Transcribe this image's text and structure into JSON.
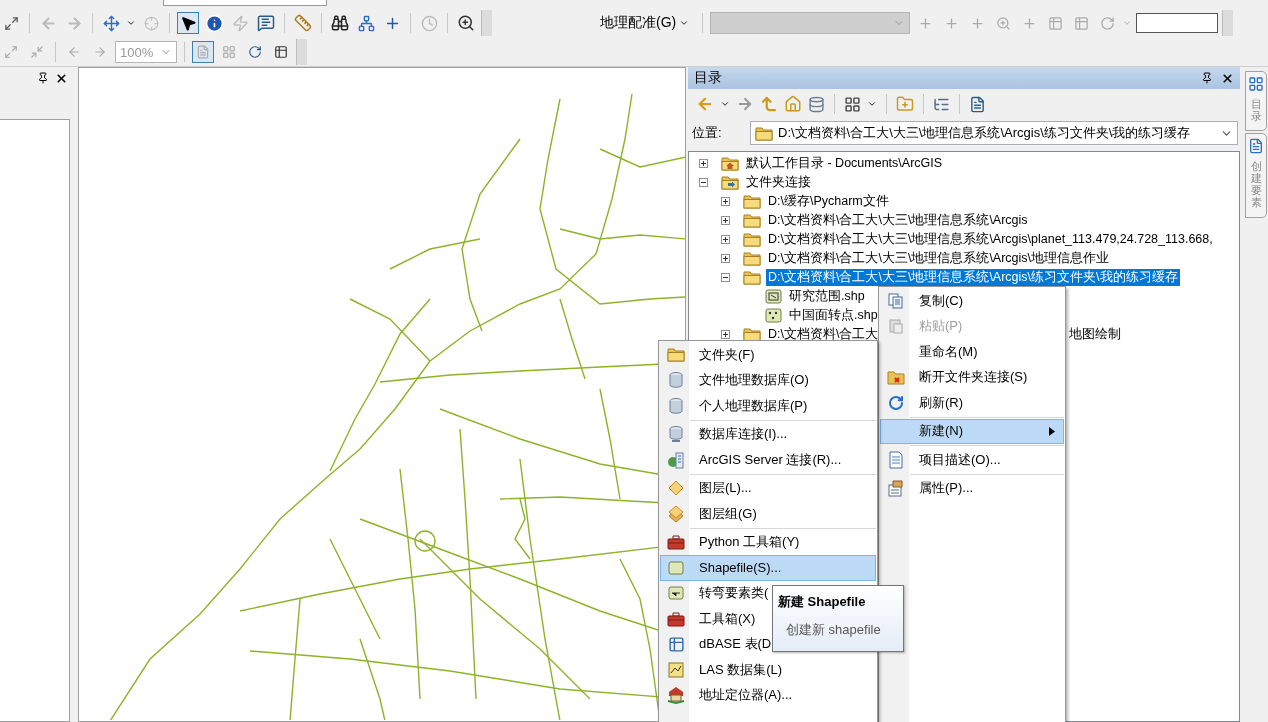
{
  "toolbar": {
    "pointer_tool": {
      "selected": true
    },
    "georeferencing_menu": "地理配准(G)",
    "page_zoom": "100%",
    "data_view_tool": {
      "selected": true
    }
  },
  "catalog": {
    "title": "目录",
    "location_label": "位置:",
    "location": "D:\\文档资料\\合工大\\大三\\地理信息系统\\Arcgis\\练习文件夹\\我的练习缓存",
    "tree": [
      {
        "kind": "home_folder",
        "label": "默认工作目录 - Documents\\ArcGIS",
        "expanded": false,
        "selected": false
      },
      {
        "kind": "connections",
        "label": "文件夹连接",
        "expanded": true,
        "selected": false,
        "children": [
          {
            "kind": "folder",
            "label": "D:\\缓存\\Pycharm文件",
            "expanded": false,
            "selected": false
          },
          {
            "kind": "folder",
            "label": "D:\\文档资料\\合工大\\大三\\地理信息系统\\Arcgis",
            "expanded": false,
            "selected": false
          },
          {
            "kind": "folder",
            "label": "D:\\文档资料\\合工大\\大三\\地理信息系统\\Arcgis\\planet_113.479,24.728_113.668,",
            "expanded": false,
            "selected": false
          },
          {
            "kind": "folder",
            "label": "D:\\文档资料\\合工大\\大三\\地理信息系统\\Arcgis\\地理信息作业",
            "expanded": false,
            "selected": false
          },
          {
            "kind": "folder",
            "label": "D:\\文档资料\\合工大\\大三\\地理信息系统\\Arcgis\\练习文件夹\\我的练习缓存",
            "expanded": true,
            "selected": true,
            "children": [
              {
                "kind": "polygon_shapefile",
                "label": "研究范围.shp",
                "selected": false
              },
              {
                "kind": "point_shapefile",
                "label": "中国面转点.shp",
                "selected": false
              }
            ]
          },
          {
            "kind": "folder",
            "label": "D:\\文档资料\\合工大",
            "label_tail": "地图绘制",
            "expanded": false,
            "selected": false
          }
        ]
      }
    ]
  },
  "context_menu": {
    "items": [
      {
        "kind": "item",
        "label": "复制(C)",
        "disabled": false,
        "selected": false,
        "submenu": false
      },
      {
        "kind": "item",
        "label": "粘贴(P)",
        "disabled": true,
        "selected": false,
        "submenu": false
      },
      {
        "kind": "item",
        "label": "重命名(M)",
        "disabled": false,
        "selected": false,
        "submenu": false
      },
      {
        "kind": "item",
        "label": "断开文件夹连接(S)",
        "disabled": false,
        "selected": false,
        "submenu": false
      },
      {
        "kind": "item",
        "label": "刷新(R)",
        "disabled": false,
        "selected": false,
        "submenu": false
      },
      {
        "kind": "separator"
      },
      {
        "kind": "item",
        "label": "新建(N)",
        "disabled": false,
        "selected": true,
        "submenu": true
      },
      {
        "kind": "separator"
      },
      {
        "kind": "item",
        "label": "项目描述(O)...",
        "disabled": false,
        "selected": false,
        "submenu": false
      },
      {
        "kind": "separator"
      },
      {
        "kind": "item",
        "label": "属性(P)...",
        "disabled": false,
        "selected": false,
        "submenu": false
      }
    ]
  },
  "new_submenu": {
    "items": [
      {
        "kind": "item",
        "label": "文件夹(F)",
        "disabled": false,
        "selected": false,
        "submenu": false
      },
      {
        "kind": "item",
        "label": "文件地理数据库(O)",
        "disabled": false,
        "selected": false,
        "submenu": false
      },
      {
        "kind": "item",
        "label": "个人地理数据库(P)",
        "disabled": false,
        "selected": false,
        "submenu": false
      },
      {
        "kind": "separator"
      },
      {
        "kind": "item",
        "label": "数据库连接(I)...",
        "disabled": false,
        "selected": false,
        "submenu": false
      },
      {
        "kind": "item",
        "label": "ArcGIS Server 连接(R)...",
        "disabled": false,
        "selected": false,
        "submenu": false
      },
      {
        "kind": "separator"
      },
      {
        "kind": "item",
        "label": "图层(L)...",
        "disabled": false,
        "selected": false,
        "submenu": false
      },
      {
        "kind": "item",
        "label": "图层组(G)",
        "disabled": false,
        "selected": false,
        "submenu": false
      },
      {
        "kind": "separator"
      },
      {
        "kind": "item",
        "label": "Python 工具箱(Y)",
        "disabled": false,
        "selected": false,
        "submenu": false
      },
      {
        "kind": "item",
        "label": "Shapefile(S)...",
        "disabled": false,
        "selected": true,
        "submenu": false
      },
      {
        "kind": "item",
        "label": "转弯要素类(",
        "disabled": false,
        "selected": false,
        "submenu": false
      },
      {
        "kind": "item",
        "label": "工具箱(X)",
        "disabled": false,
        "selected": false,
        "submenu": false
      },
      {
        "kind": "item",
        "label": "dBASE 表(D",
        "disabled": false,
        "selected": false,
        "submenu": false
      },
      {
        "kind": "item",
        "label": "LAS 数据集(L)",
        "disabled": false,
        "selected": false,
        "submenu": false
      },
      {
        "kind": "item",
        "label": "地址定位器(A)...",
        "disabled": false,
        "selected": false,
        "submenu": false
      }
    ]
  },
  "tooltip": {
    "title": "新建 Shapefile",
    "text": "创建新 shapefile"
  },
  "side_tabs": [
    {
      "label": "目录"
    },
    {
      "label": "创建要素"
    }
  ]
}
